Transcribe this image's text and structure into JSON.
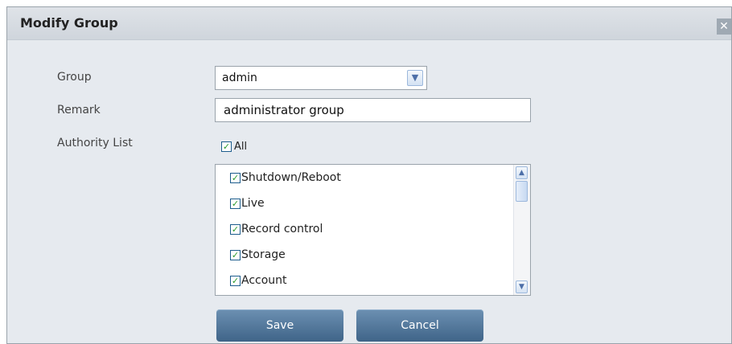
{
  "dialog": {
    "title": "Modify Group",
    "close_icon": "close-icon"
  },
  "form": {
    "group_label": "Group",
    "group_value": "admin",
    "remark_label": "Remark",
    "remark_value": "administrator group",
    "authority_label": "Authority List",
    "all_label": "All",
    "all_checked": true
  },
  "authority_list": {
    "items": [
      {
        "label": "Shutdown/Reboot",
        "checked": true
      },
      {
        "label": "Live",
        "checked": true
      },
      {
        "label": "Record control",
        "checked": true
      },
      {
        "label": "Storage",
        "checked": true
      },
      {
        "label": "Account",
        "checked": true
      }
    ]
  },
  "buttons": {
    "save_label": "Save",
    "cancel_label": "Cancel"
  },
  "colors": {
    "button": "#4f7499",
    "check": "#2a9a2a",
    "background": "#e6eaef"
  }
}
